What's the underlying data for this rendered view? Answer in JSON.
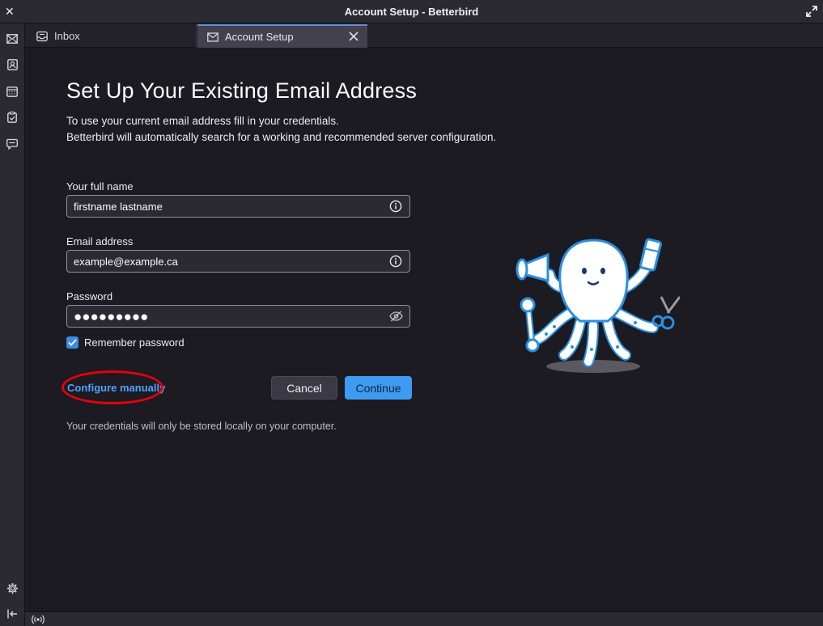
{
  "window": {
    "title": "Account Setup - Betterbird",
    "close_glyph": "✕"
  },
  "spaces_toolbar": {
    "items": [
      {
        "name": "mail-icon"
      },
      {
        "name": "address-book-icon"
      },
      {
        "name": "calendar-icon"
      },
      {
        "name": "tasks-icon"
      },
      {
        "name": "chat-icon"
      }
    ],
    "bottom": [
      {
        "name": "settings-gear-icon"
      },
      {
        "name": "collapse-toolbar-icon"
      }
    ]
  },
  "tabs": [
    {
      "label": "Inbox",
      "icon": "inbox-tray-icon",
      "active": false
    },
    {
      "label": "Account Setup",
      "icon": "account-setup-envelope-icon",
      "active": true
    }
  ],
  "form": {
    "heading": "Set Up Your Existing Email Address",
    "description_line1": "To use your current email address fill in your credentials.",
    "description_line2": "Betterbird will automatically search for a working and recommended server configuration.",
    "full_name": {
      "label": "Your full name",
      "value": "firstname lastname"
    },
    "email": {
      "label": "Email address",
      "value": "example@example.ca"
    },
    "password": {
      "label": "Password",
      "value": "●●●●●●●●●"
    },
    "remember_password": {
      "label": "Remember password",
      "checked": true
    },
    "configure_manually": "Configure manually",
    "cancel": "Cancel",
    "continue": "Continue",
    "footnote": "Your credentials will only be stored locally on your computer."
  },
  "colors": {
    "accent": "#3e9bf2",
    "link": "#4ea3ff",
    "annotation": "#e8000b"
  }
}
